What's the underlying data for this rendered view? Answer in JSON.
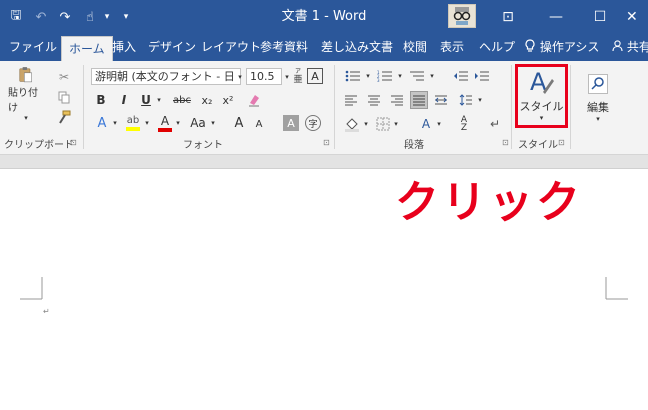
{
  "window": {
    "title": "文書 1 - Word",
    "controls": {
      "ribbon_display": "⊡",
      "minimize": "—",
      "maximize": "☐",
      "close": "✕"
    }
  },
  "quick_access": {
    "save": "🖫",
    "undo": "↶",
    "redo": "↷",
    "touch": "☝",
    "customize": "▾"
  },
  "tabs": [
    {
      "label": "ファイル"
    },
    {
      "label": "ホーム",
      "active": true
    },
    {
      "label": "挿入"
    },
    {
      "label": "デザイン"
    },
    {
      "label": "レイアウト"
    },
    {
      "label": "参考資料"
    },
    {
      "label": "差し込み文書"
    },
    {
      "label": "校閲"
    },
    {
      "label": "表示"
    },
    {
      "label": "ヘルプ"
    },
    {
      "label": "操作アシス"
    },
    {
      "label": "共有"
    }
  ],
  "ribbon": {
    "clipboard": {
      "label": "クリップボード",
      "paste": "貼り付け",
      "launcher": "⊡"
    },
    "font": {
      "label": "フォント",
      "font_name": "游明朝 (本文のフォント - 日",
      "font_size": "10.5",
      "bold": "B",
      "italic": "I",
      "underline": "U",
      "strike": "abc",
      "subscript": "x₂",
      "superscript": "x²",
      "grow": "A",
      "shrink": "A",
      "case": "Aa",
      "launcher": "⊡"
    },
    "paragraph": {
      "label": "段落",
      "launcher": "⊡"
    },
    "styles": {
      "label": "スタイル",
      "button": "スタイル",
      "launcher": "⊡"
    },
    "editing": {
      "button": "編集"
    }
  },
  "document": {
    "paragraph_mark": "↵"
  },
  "annotation": {
    "text": "クリック",
    "color": "#e8001c"
  },
  "colors": {
    "word_blue": "#2b579a",
    "ribbon_bg": "#f3f3f3",
    "highlight_red": "#e8001c"
  }
}
